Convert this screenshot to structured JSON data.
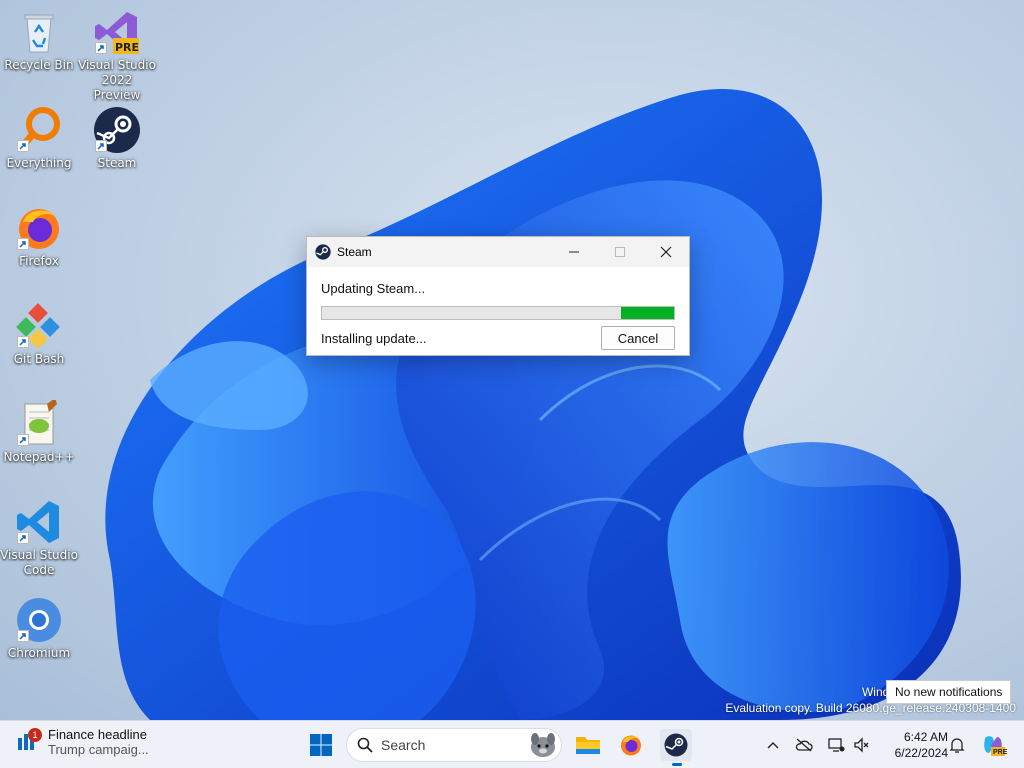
{
  "desktop": {
    "icons": [
      {
        "label": "Recycle Bin"
      },
      {
        "label": "Visual Studio 2022 Preview",
        "badge": "PRE"
      },
      {
        "label": "Everything"
      },
      {
        "label": "Steam"
      },
      {
        "label": "Firefox"
      },
      {
        "label": "Git Bash"
      },
      {
        "label": "Notepad++"
      },
      {
        "label": "Visual Studio Code"
      },
      {
        "label": "Chromium"
      }
    ]
  },
  "steam_window": {
    "title": "Steam",
    "status": "Updating Steam...",
    "progress": 0.15,
    "substatus": "Installing update...",
    "cancel_label": "Cancel"
  },
  "watermark": {
    "line1": "Windo",
    "line2": "Evaluation copy. Build 26080.ge_release.240308-1400"
  },
  "notification_tip": "No new notifications",
  "taskbar": {
    "news": {
      "badge": "1",
      "headline": "Finance headline",
      "subline": "Trump campaig..."
    },
    "search_placeholder": "Search",
    "clock": {
      "time": "6:42 AM",
      "date": "6/22/2024"
    },
    "copilot_badge": "PRE"
  },
  "colors": {
    "progress_fill": "#06b025",
    "accent": "#0067c0"
  }
}
